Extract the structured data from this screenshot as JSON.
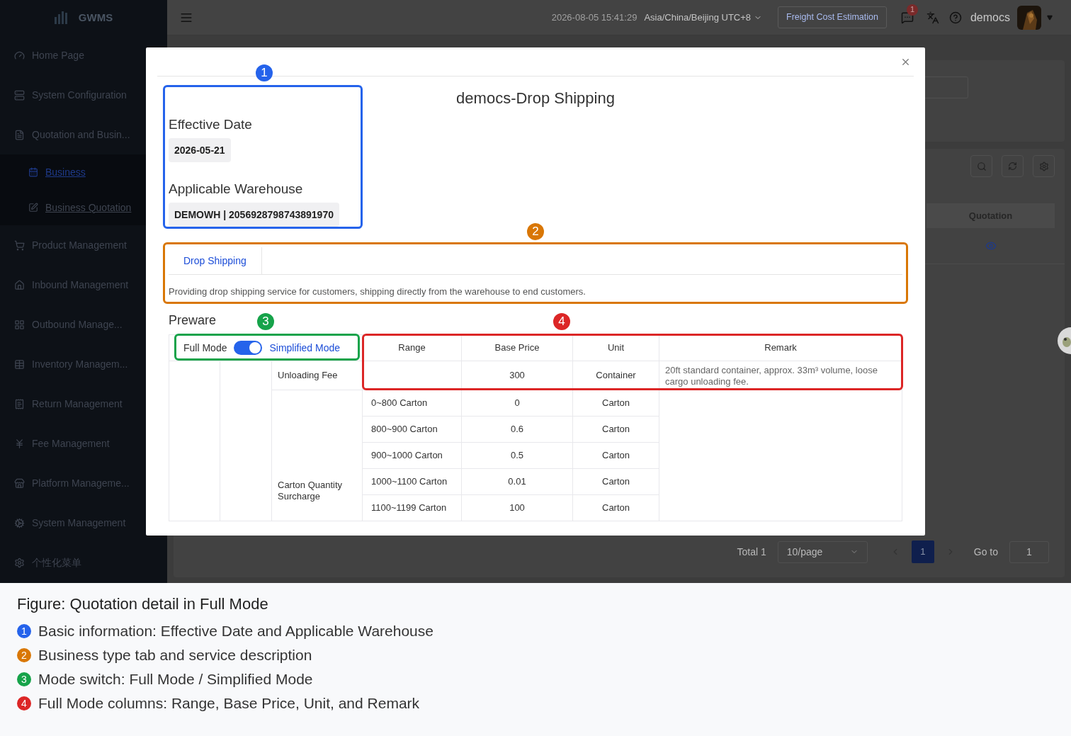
{
  "app": {
    "name": "GWMS"
  },
  "sidebar": {
    "items": [
      {
        "label": "Home Page",
        "selected": false
      },
      {
        "label": "System Configuration",
        "selected": false
      },
      {
        "label": "Quotation and Busin...",
        "selected": false,
        "children": [
          {
            "label": "Business",
            "selected": true
          },
          {
            "label": "Business Quotation",
            "selected": false
          }
        ]
      },
      {
        "label": "Product Management",
        "selected": false
      },
      {
        "label": "Inbound Management",
        "selected": false
      },
      {
        "label": "Outbound Manage...",
        "selected": false
      },
      {
        "label": "Inventory Managem...",
        "selected": false
      },
      {
        "label": "Return Management",
        "selected": false
      },
      {
        "label": "Fee Management",
        "selected": false
      },
      {
        "label": "Platform Manageme...",
        "selected": false
      },
      {
        "label": "System Management",
        "selected": false
      },
      {
        "label": "个性化菜单",
        "selected": false
      }
    ]
  },
  "header": {
    "datetime": "2026-08-05 15:41:29",
    "timezone": "Asia/China/Beijing UTC+8",
    "estimate_button": "Freight Cost Estimation",
    "notifications_badge": "1",
    "user": "democs"
  },
  "background": {
    "table_column": "Quotation",
    "pagination": {
      "total": "Total 1",
      "page_size": "10/page",
      "pages": [
        {
          "label": "1",
          "selected": true
        }
      ],
      "goto_label": "Go to",
      "goto_value": "1"
    }
  },
  "modal": {
    "title": "democs-Drop Shipping",
    "fields": [
      {
        "label": "Effective Date",
        "value": "2026-05-21"
      },
      {
        "label": "Applicable Warehouse",
        "value": "DEMOWH | 2056928798743891970"
      }
    ],
    "tabs": [
      {
        "label": "Drop Shipping",
        "selected": true
      }
    ],
    "description": "Providing drop shipping service for customers, shipping directly from the warehouse to end customers.",
    "section_title": "Preware",
    "mode_switch": {
      "off_label": "Full Mode",
      "on_label": "Simplified Mode",
      "on": true
    },
    "table": {
      "columns": [
        "Range",
        "Base Price",
        "Unit",
        "Remark"
      ],
      "groups": [
        {
          "name": "Unloading Fee",
          "remark": "20ft standard container, approx. 33m³ volume, loose cargo unloading fee.",
          "rows": [
            {
              "range": "",
              "base_price": "300",
              "unit": "Container"
            }
          ]
        },
        {
          "name": "Carton Quantity Surcharge",
          "rows": [
            {
              "range": "0~800 Carton",
              "base_price": "0",
              "unit": "Carton"
            },
            {
              "range": "800~900 Carton",
              "base_price": "0.6",
              "unit": "Carton"
            },
            {
              "range": "900~1000 Carton",
              "base_price": "0.5",
              "unit": "Carton"
            },
            {
              "range": "1000~1100 Carton",
              "base_price": "0.01",
              "unit": "Carton"
            },
            {
              "range": "1100~1199 Carton",
              "base_price": "100",
              "unit": "Carton"
            }
          ]
        }
      ]
    }
  },
  "annotations": [
    {
      "number": "1",
      "color": "#2563eb"
    },
    {
      "number": "2",
      "color": "#d97706"
    },
    {
      "number": "3",
      "color": "#16a34a"
    },
    {
      "number": "4",
      "color": "#dc2626"
    }
  ],
  "figure": {
    "caption": "Figure: Quotation detail in Full Mode",
    "legend": [
      {
        "number": "1",
        "color": "#2563eb",
        "text": "Basic information: Effective Date and Applicable Warehouse"
      },
      {
        "number": "2",
        "color": "#d97706",
        "text": "Business type tab and service description"
      },
      {
        "number": "3",
        "color": "#16a34a",
        "text": "Mode switch: Full Mode / Simplified Mode"
      },
      {
        "number": "4",
        "color": "#dc2626",
        "text": "Full Mode columns: Range, Base Price, Unit, and Remark"
      }
    ]
  }
}
